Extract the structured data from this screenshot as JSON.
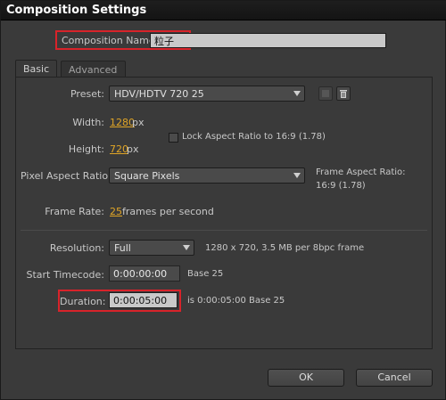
{
  "window": {
    "title": "Composition Settings"
  },
  "comp_name": {
    "label": "Composition Name:",
    "value": "粒子"
  },
  "tabs": [
    {
      "label": "Basic"
    },
    {
      "label": "Advanced"
    }
  ],
  "preset": {
    "label": "Preset:",
    "value": "HDV/HDTV 720 25"
  },
  "width": {
    "label": "Width:",
    "value": "1280",
    "unit": "px"
  },
  "height": {
    "label": "Height:",
    "value": "720",
    "unit": "px"
  },
  "lock_aspect": {
    "label": "Lock Aspect Ratio to 16:9 (1.78)",
    "checked": false
  },
  "pixel_aspect": {
    "label": "Pixel Aspect Ratio:",
    "value": "Square Pixels"
  },
  "frame_aspect": {
    "label": "Frame Aspect Ratio:",
    "value": "16:9 (1.78)"
  },
  "frame_rate": {
    "label": "Frame Rate:",
    "value": "25",
    "unit": "frames per second"
  },
  "resolution": {
    "label": "Resolution:",
    "value": "Full",
    "info": "1280 x 720, 3.5 MB per 8bpc frame"
  },
  "start_timecode": {
    "label": "Start Timecode:",
    "value": "0:00:00:00",
    "base": "Base 25"
  },
  "duration": {
    "label": "Duration:",
    "value": "0:00:05:00",
    "info": "is 0:00:05:00  Base 25"
  },
  "buttons": {
    "ok": "OK",
    "cancel": "Cancel"
  },
  "colors": {
    "highlight": "#d8232a",
    "link": "#e0a526"
  }
}
